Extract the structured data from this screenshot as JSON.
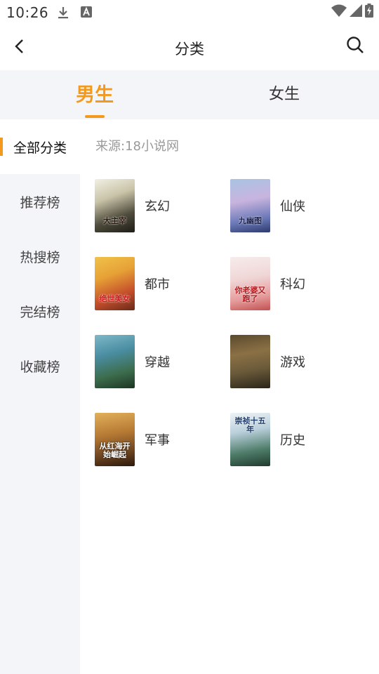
{
  "status_bar": {
    "time": "10:26",
    "icons": [
      "download-icon",
      "font-a-icon",
      "wifi-icon",
      "signal-icon",
      "battery-charging-icon"
    ]
  },
  "header": {
    "title": "分类",
    "back_icon": "chevron-left-icon",
    "search_icon": "search-icon"
  },
  "gender_tabs": [
    {
      "label": "男生",
      "active": true
    },
    {
      "label": "女生",
      "active": false
    }
  ],
  "accent_color": "#f39a1e",
  "sidebar": {
    "items": [
      {
        "label": "全部分类",
        "active": true
      },
      {
        "label": "推荐榜",
        "active": false
      },
      {
        "label": "热搜榜",
        "active": false
      },
      {
        "label": "完结榜",
        "active": false
      },
      {
        "label": "收藏榜",
        "active": false
      }
    ]
  },
  "content": {
    "source": "来源:18小说网",
    "categories": [
      {
        "label": "玄幻",
        "cover_text": "大主宰"
      },
      {
        "label": "仙侠",
        "cover_text": "九幽图"
      },
      {
        "label": "都市",
        "cover_text": "绝世美女"
      },
      {
        "label": "科幻",
        "cover_text": "你老婆又跑了"
      },
      {
        "label": "穿越",
        "cover_text": ""
      },
      {
        "label": "游戏",
        "cover_text": ""
      },
      {
        "label": "军事",
        "cover_text": "从红海开始崛起"
      },
      {
        "label": "历史",
        "cover_text": "崇祯十五年"
      }
    ]
  }
}
